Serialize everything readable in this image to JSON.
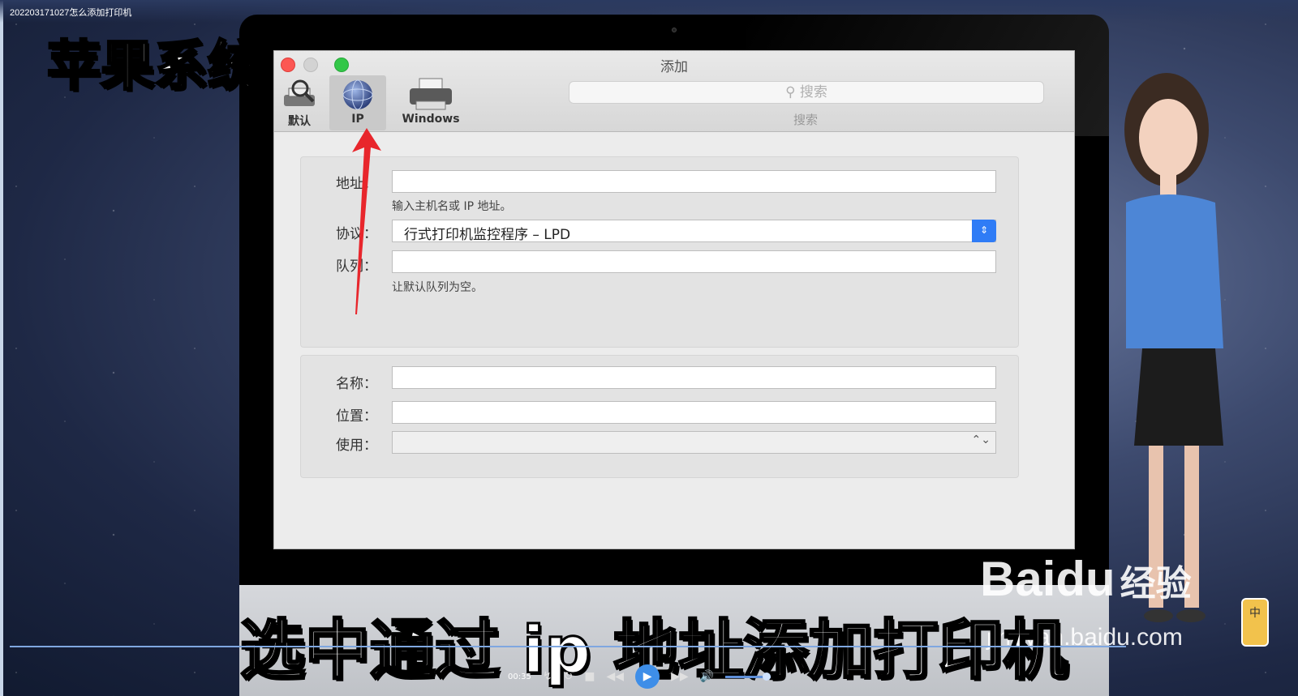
{
  "video": {
    "file_title": "202203171027怎么添加打印机",
    "overlay_title": "苹果系统",
    "subtitle": "选中通过 ip 地址添加打印机",
    "time": "00:35"
  },
  "watermark": {
    "logo": "Baidu",
    "text": "经验",
    "url": "jingyan.baidu.com"
  },
  "ime_badge": "中",
  "window": {
    "title": "添加",
    "toolbar": {
      "default_label": "默认",
      "ip_label": "IP",
      "windows_label": "Windows"
    },
    "search": {
      "placeholder": "搜索",
      "caption": "搜索"
    },
    "form": {
      "address_label": "地址：",
      "address_value": "",
      "address_hint": "输入主机名或 IP 地址。",
      "protocol_label": "协议：",
      "protocol_value": "行式打印机监控程序 – LPD",
      "queue_label": "队列：",
      "queue_value": "",
      "queue_hint": "让默认队列为空。",
      "name_label": "名称：",
      "name_value": "",
      "location_label": "位置：",
      "location_value": "",
      "use_label": "使用：",
      "use_value": ""
    }
  },
  "colors": {
    "active_select": "#2f7cf6",
    "arrow": "#e8262c",
    "close": "#fc5753",
    "zoom": "#33c748"
  }
}
